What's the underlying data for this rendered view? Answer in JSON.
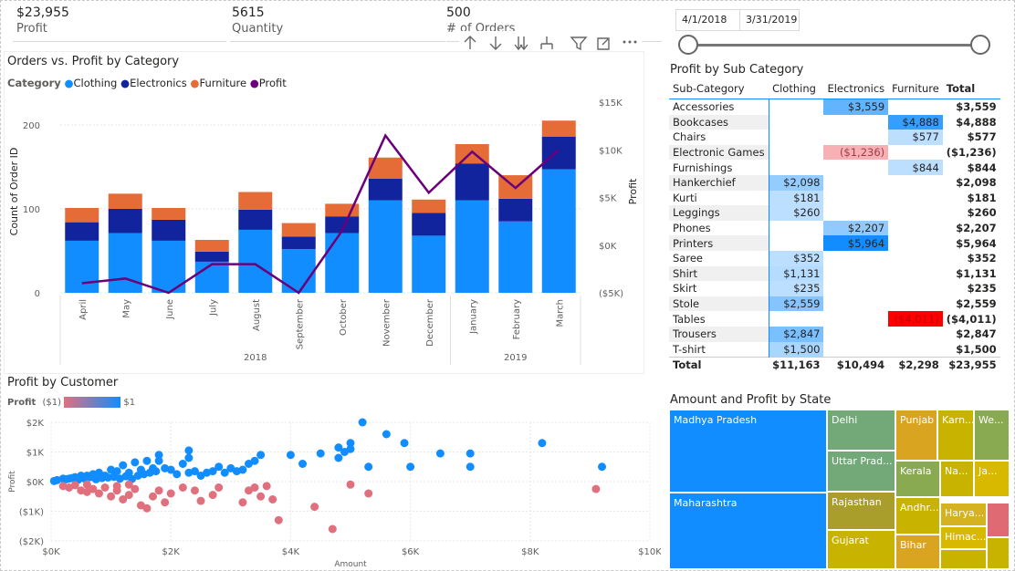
{
  "kpis": [
    {
      "value": "$23,955",
      "label": "Profit"
    },
    {
      "value": "5615",
      "label": "Quantity"
    },
    {
      "value": "500",
      "label": "# of Orders"
    }
  ],
  "toolbar": {
    "icons": [
      "drill-up-icon",
      "drill-down-icon",
      "expand-all-icon",
      "expand-hierarchy-icon",
      "filter-icon",
      "focus-mode-icon",
      "more-options-icon"
    ]
  },
  "slicer": {
    "start_date": "4/1/2018",
    "end_date": "3/31/2019",
    "range": [
      0,
      1
    ]
  },
  "combo": {
    "title": "Orders vs. Profit by Category",
    "legend_title": "Category",
    "legend": [
      {
        "name": "Clothing",
        "color": "#118dff"
      },
      {
        "name": "Electronics",
        "color": "#12239e"
      },
      {
        "name": "Furniture",
        "color": "#e66c37"
      },
      {
        "name": "Profit",
        "color": "#6b007b"
      }
    ],
    "y_label": "Count of Order ID",
    "y2_label": "Profit",
    "y_ticks": [
      "0",
      "100",
      "200"
    ],
    "y2_ticks": [
      "($5K)",
      "$0K",
      "$5K",
      "$10K",
      "$15K"
    ],
    "years": [
      "2018",
      "2019"
    ]
  },
  "chart_data": [
    {
      "type": "bar",
      "title": "Orders vs. Profit by Category",
      "categories": [
        "April",
        "May",
        "June",
        "July",
        "August",
        "September",
        "October",
        "November",
        "December",
        "January",
        "February",
        "March"
      ],
      "series": [
        {
          "name": "Clothing",
          "values": [
            62,
            71,
            62,
            37,
            75,
            52,
            71,
            110,
            68,
            110,
            85,
            147
          ]
        },
        {
          "name": "Electronics",
          "values": [
            22,
            29,
            25,
            12,
            24,
            15,
            20,
            26,
            27,
            44,
            27,
            39
          ]
        },
        {
          "name": "Furniture",
          "values": [
            17,
            18,
            14,
            14,
            21,
            16,
            15,
            25,
            16,
            23,
            28,
            19
          ]
        },
        {
          "name": "Profit",
          "values": [
            -4000,
            -3500,
            -5000,
            -2000,
            -2000,
            -5000,
            1500,
            11500,
            5500,
            9800,
            6000,
            10000
          ]
        }
      ],
      "ylabel": "Count of Order ID",
      "y2label": "Profit",
      "ylim": [
        0,
        240
      ],
      "y2lim": [
        -5000,
        15000
      ]
    },
    {
      "type": "scatter",
      "title": "Profit by Customer",
      "xlabel": "Amount",
      "ylabel": "Profit",
      "xlim": [
        0,
        10000
      ],
      "ylim": [
        -2000,
        2000
      ],
      "x_ticks": [
        "$0K",
        "$2K",
        "$4K",
        "$6K",
        "$8K",
        "$10K"
      ],
      "y_ticks": [
        "$2K",
        "$1K",
        "$0K",
        "($1K)",
        "($2K)"
      ],
      "gradient": {
        "label": "Profit",
        "min": "($1)",
        "max": "$1",
        "min_color": "#e0707e",
        "max_color": "#118dff"
      },
      "points": [
        [
          5200,
          2000
        ],
        [
          5600,
          1600
        ],
        [
          5900,
          1300
        ],
        [
          4800,
          1150
        ],
        [
          5000,
          1300
        ],
        [
          6500,
          950
        ],
        [
          7000,
          950
        ],
        [
          8200,
          1300
        ],
        [
          9200,
          500
        ],
        [
          7000,
          500
        ],
        [
          6000,
          500
        ],
        [
          5300,
          500
        ],
        [
          4800,
          800
        ],
        [
          4900,
          1000
        ],
        [
          5000,
          1100
        ],
        [
          4500,
          950
        ],
        [
          4200,
          600
        ],
        [
          4000,
          900
        ],
        [
          3500,
          900
        ],
        [
          3400,
          700
        ],
        [
          3300,
          600
        ],
        [
          3000,
          450
        ],
        [
          2800,
          500
        ],
        [
          2400,
          350
        ],
        [
          2200,
          600
        ],
        [
          2300,
          300
        ],
        [
          2000,
          400
        ],
        [
          2300,
          800
        ],
        [
          2300,
          1050
        ],
        [
          1800,
          700
        ],
        [
          1800,
          900
        ],
        [
          1600,
          700
        ],
        [
          1400,
          650
        ],
        [
          1200,
          550
        ],
        [
          1300,
          300
        ],
        [
          1100,
          350
        ],
        [
          1000,
          400
        ],
        [
          900,
          200
        ],
        [
          800,
          300
        ],
        [
          700,
          250
        ],
        [
          600,
          200
        ],
        [
          500,
          200
        ],
        [
          400,
          150
        ],
        [
          300,
          100
        ],
        [
          200,
          100
        ],
        [
          100,
          50
        ],
        [
          50,
          20
        ],
        [
          250,
          80
        ],
        [
          350,
          120
        ],
        [
          450,
          60
        ],
        [
          550,
          110
        ],
        [
          650,
          150
        ],
        [
          750,
          80
        ],
        [
          850,
          120
        ],
        [
          950,
          140
        ],
        [
          1050,
          160
        ],
        [
          1150,
          100
        ],
        [
          1250,
          180
        ],
        [
          1350,
          90
        ],
        [
          1450,
          200
        ],
        [
          1550,
          250
        ],
        [
          1650,
          300
        ],
        [
          1750,
          350
        ],
        [
          2100,
          250
        ],
        [
          2500,
          200
        ],
        [
          2600,
          300
        ],
        [
          2700,
          350
        ],
        [
          2900,
          300
        ],
        [
          3100,
          350
        ],
        [
          3200,
          400
        ],
        [
          1500,
          400
        ],
        [
          1700,
          450
        ],
        [
          1900,
          450
        ],
        [
          200,
          -150
        ],
        [
          300,
          -200
        ],
        [
          400,
          -120
        ],
        [
          500,
          -300
        ],
        [
          600,
          -350
        ],
        [
          700,
          -250
        ],
        [
          800,
          -400
        ],
        [
          900,
          -200
        ],
        [
          1000,
          -500
        ],
        [
          1100,
          -300
        ],
        [
          1200,
          -600
        ],
        [
          1300,
          -450
        ],
        [
          1400,
          -250
        ],
        [
          1500,
          -800
        ],
        [
          1600,
          -900
        ],
        [
          1700,
          -500
        ],
        [
          1800,
          -300
        ],
        [
          1900,
          -700
        ],
        [
          2000,
          -400
        ],
        [
          2200,
          -200
        ],
        [
          2400,
          -300
        ],
        [
          2500,
          -650
        ],
        [
          2700,
          -450
        ],
        [
          2800,
          -200
        ],
        [
          3200,
          -700
        ],
        [
          3300,
          -300
        ],
        [
          3500,
          -500
        ],
        [
          3600,
          -150
        ],
        [
          3700,
          -600
        ],
        [
          3800,
          -1300
        ],
        [
          4400,
          -850
        ],
        [
          5300,
          -400
        ],
        [
          9100,
          -250
        ],
        [
          4700,
          -1600
        ],
        [
          5000,
          -100
        ],
        [
          3400,
          -200
        ],
        [
          1300,
          -100
        ],
        [
          1100,
          -150
        ],
        [
          600,
          -100
        ]
      ]
    }
  ],
  "matrix": {
    "title": "Profit by Sub Category",
    "headers": [
      "Sub-Category",
      "Clothing",
      "Electronics",
      "Furniture",
      "Total"
    ],
    "rows": [
      {
        "label": "Accessories",
        "cells": [
          "",
          "$3,559",
          ""
        ],
        "total": "$3,559",
        "levels": [
          0,
          0.6,
          0
        ]
      },
      {
        "label": "Bookcases",
        "cells": [
          "",
          "",
          "$4,888"
        ],
        "total": "$4,888",
        "levels": [
          0,
          0,
          0.82
        ]
      },
      {
        "label": "Chairs",
        "cells": [
          "",
          "",
          "$577"
        ],
        "total": "$577",
        "levels": [
          0,
          0,
          0.1
        ]
      },
      {
        "label": "Electronic Games",
        "cells": [
          "",
          "($1,236)",
          ""
        ],
        "total": "($1,236)",
        "levels": [
          0,
          -0.3,
          0
        ]
      },
      {
        "label": "Furnishings",
        "cells": [
          "",
          "",
          "$844"
        ],
        "total": "$844",
        "levels": [
          0,
          0,
          0.14
        ]
      },
      {
        "label": "Hankerchief",
        "cells": [
          "$2,098",
          "",
          ""
        ],
        "total": "$2,098",
        "levels": [
          0.35,
          0,
          0
        ]
      },
      {
        "label": "Kurti",
        "cells": [
          "$181",
          "",
          ""
        ],
        "total": "$181",
        "levels": [
          0.03,
          0,
          0
        ]
      },
      {
        "label": "Leggings",
        "cells": [
          "$260",
          "",
          ""
        ],
        "total": "$260",
        "levels": [
          0.04,
          0,
          0
        ]
      },
      {
        "label": "Phones",
        "cells": [
          "",
          "$2,207",
          ""
        ],
        "total": "$2,207",
        "levels": [
          0,
          0.37,
          0
        ]
      },
      {
        "label": "Printers",
        "cells": [
          "",
          "$5,964",
          ""
        ],
        "total": "$5,964",
        "levels": [
          0,
          1,
          0
        ]
      },
      {
        "label": "Saree",
        "cells": [
          "$352",
          "",
          ""
        ],
        "total": "$352",
        "levels": [
          0.06,
          0,
          0
        ]
      },
      {
        "label": "Shirt",
        "cells": [
          "$1,131",
          "",
          ""
        ],
        "total": "$1,131",
        "levels": [
          0.19,
          0,
          0
        ]
      },
      {
        "label": "Skirt",
        "cells": [
          "$235",
          "",
          ""
        ],
        "total": "$235",
        "levels": [
          0.04,
          0,
          0
        ]
      },
      {
        "label": "Stole",
        "cells": [
          "$2,559",
          "",
          ""
        ],
        "total": "$2,559",
        "levels": [
          0.43,
          0,
          0
        ]
      },
      {
        "label": "Tables",
        "cells": [
          "",
          "",
          "($4,011)"
        ],
        "total": "($4,011)",
        "levels": [
          0,
          0,
          -1
        ]
      },
      {
        "label": "Trousers",
        "cells": [
          "$2,847",
          "",
          ""
        ],
        "total": "$2,847",
        "levels": [
          0.48,
          0,
          0
        ]
      },
      {
        "label": "T-shirt",
        "cells": [
          "$1,500",
          "",
          ""
        ],
        "total": "$1,500",
        "levels": [
          0.25,
          0,
          0
        ]
      }
    ],
    "total_row": {
      "label": "Total",
      "cells": [
        "$11,163",
        "$10,494",
        "$2,298"
      ],
      "total": "$23,955"
    }
  },
  "treemap": {
    "title": "Amount and Profit by State",
    "tiles": [
      "Madhya Pradesh",
      "Maharashtra",
      "Delhi",
      "Uttar Prad...",
      "Rajasthan",
      "Gujarat",
      "Punjab",
      "Karn...",
      "We...",
      "Kerala",
      "Na...",
      "Ja...",
      "Andhr...",
      "Harya...",
      "Bihar",
      "Himac..."
    ]
  }
}
